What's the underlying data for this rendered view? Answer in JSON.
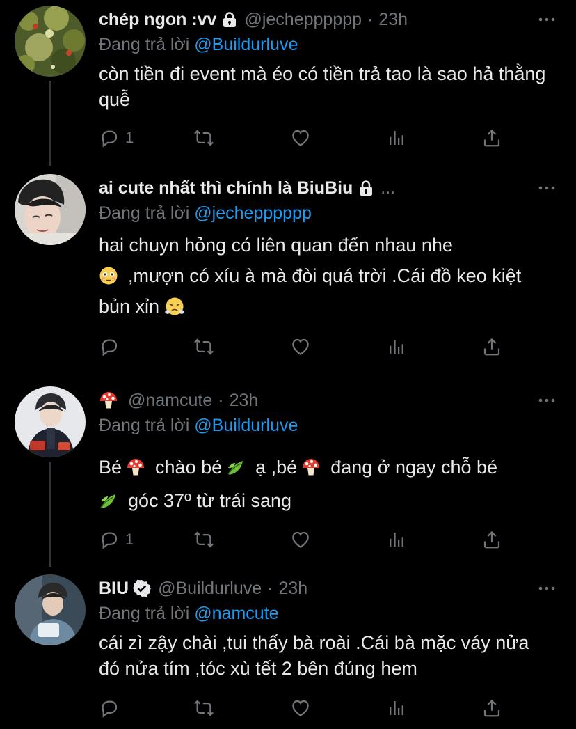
{
  "tweets": [
    {
      "name": "chép ngon :vv",
      "handle": "@jechepppppp",
      "dot": "·",
      "time": "23h",
      "reply_prefix": "Đang trả lời",
      "reply_mention": "@Buildurluve",
      "text": "còn tiền đi event mà éo có tiền trả tao là sao hả thằng quễ",
      "reply_count": "1"
    },
    {
      "name": "ai cute nhất thì chính là BiuBiu",
      "ellipsis": "...",
      "reply_prefix": "Đang trả lời",
      "reply_mention": "@jechepppppp",
      "line1": "hai chuyn hỏng có liên quan đến nhau nhe",
      "line2": ",mượn có xíu à mà đòi quá trời .Cái đồ keo kiệt",
      "line3": "bủn xỉn"
    },
    {
      "handle": "@namcute",
      "dot": "·",
      "time": "23h",
      "reply_prefix": "Đang trả lời",
      "reply_mention": "@Buildurluve",
      "seg1": "Bé",
      "seg2": "chào bé",
      "seg3": "ạ ,bé",
      "seg4": "đang ở ngay chỗ bé",
      "line2": "góc 37º từ trái sang",
      "reply_count": "1"
    },
    {
      "name": "BIU",
      "handle": "@Buildurluve",
      "dot": "·",
      "time": "23h",
      "reply_prefix": "Đang trả lời",
      "reply_mention": "@namcute",
      "text": "cái zì zậy chài ,tui thấy bà roài .Cái bà mặc váy nửa đó nửa tím ,tóc xù tết 2 bên đúng hem"
    }
  ],
  "icons": {
    "reply": "reply-icon",
    "retweet": "retweet-icon",
    "like": "heart-icon",
    "views": "analytics-icon",
    "share": "share-icon",
    "more": "more-icon",
    "lock": "lock-icon",
    "verified": "verified-badge-icon",
    "mushroom": "mushroom-emoji",
    "leaf": "leaf-emoji",
    "flushed": "flushed-face-emoji",
    "steam": "face-with-steam-emoji"
  },
  "colors": {
    "background": "#000000",
    "text": "#e7e9ea",
    "muted": "#71767b",
    "mention": "#1d9bf0",
    "thread_line": "#333639"
  }
}
